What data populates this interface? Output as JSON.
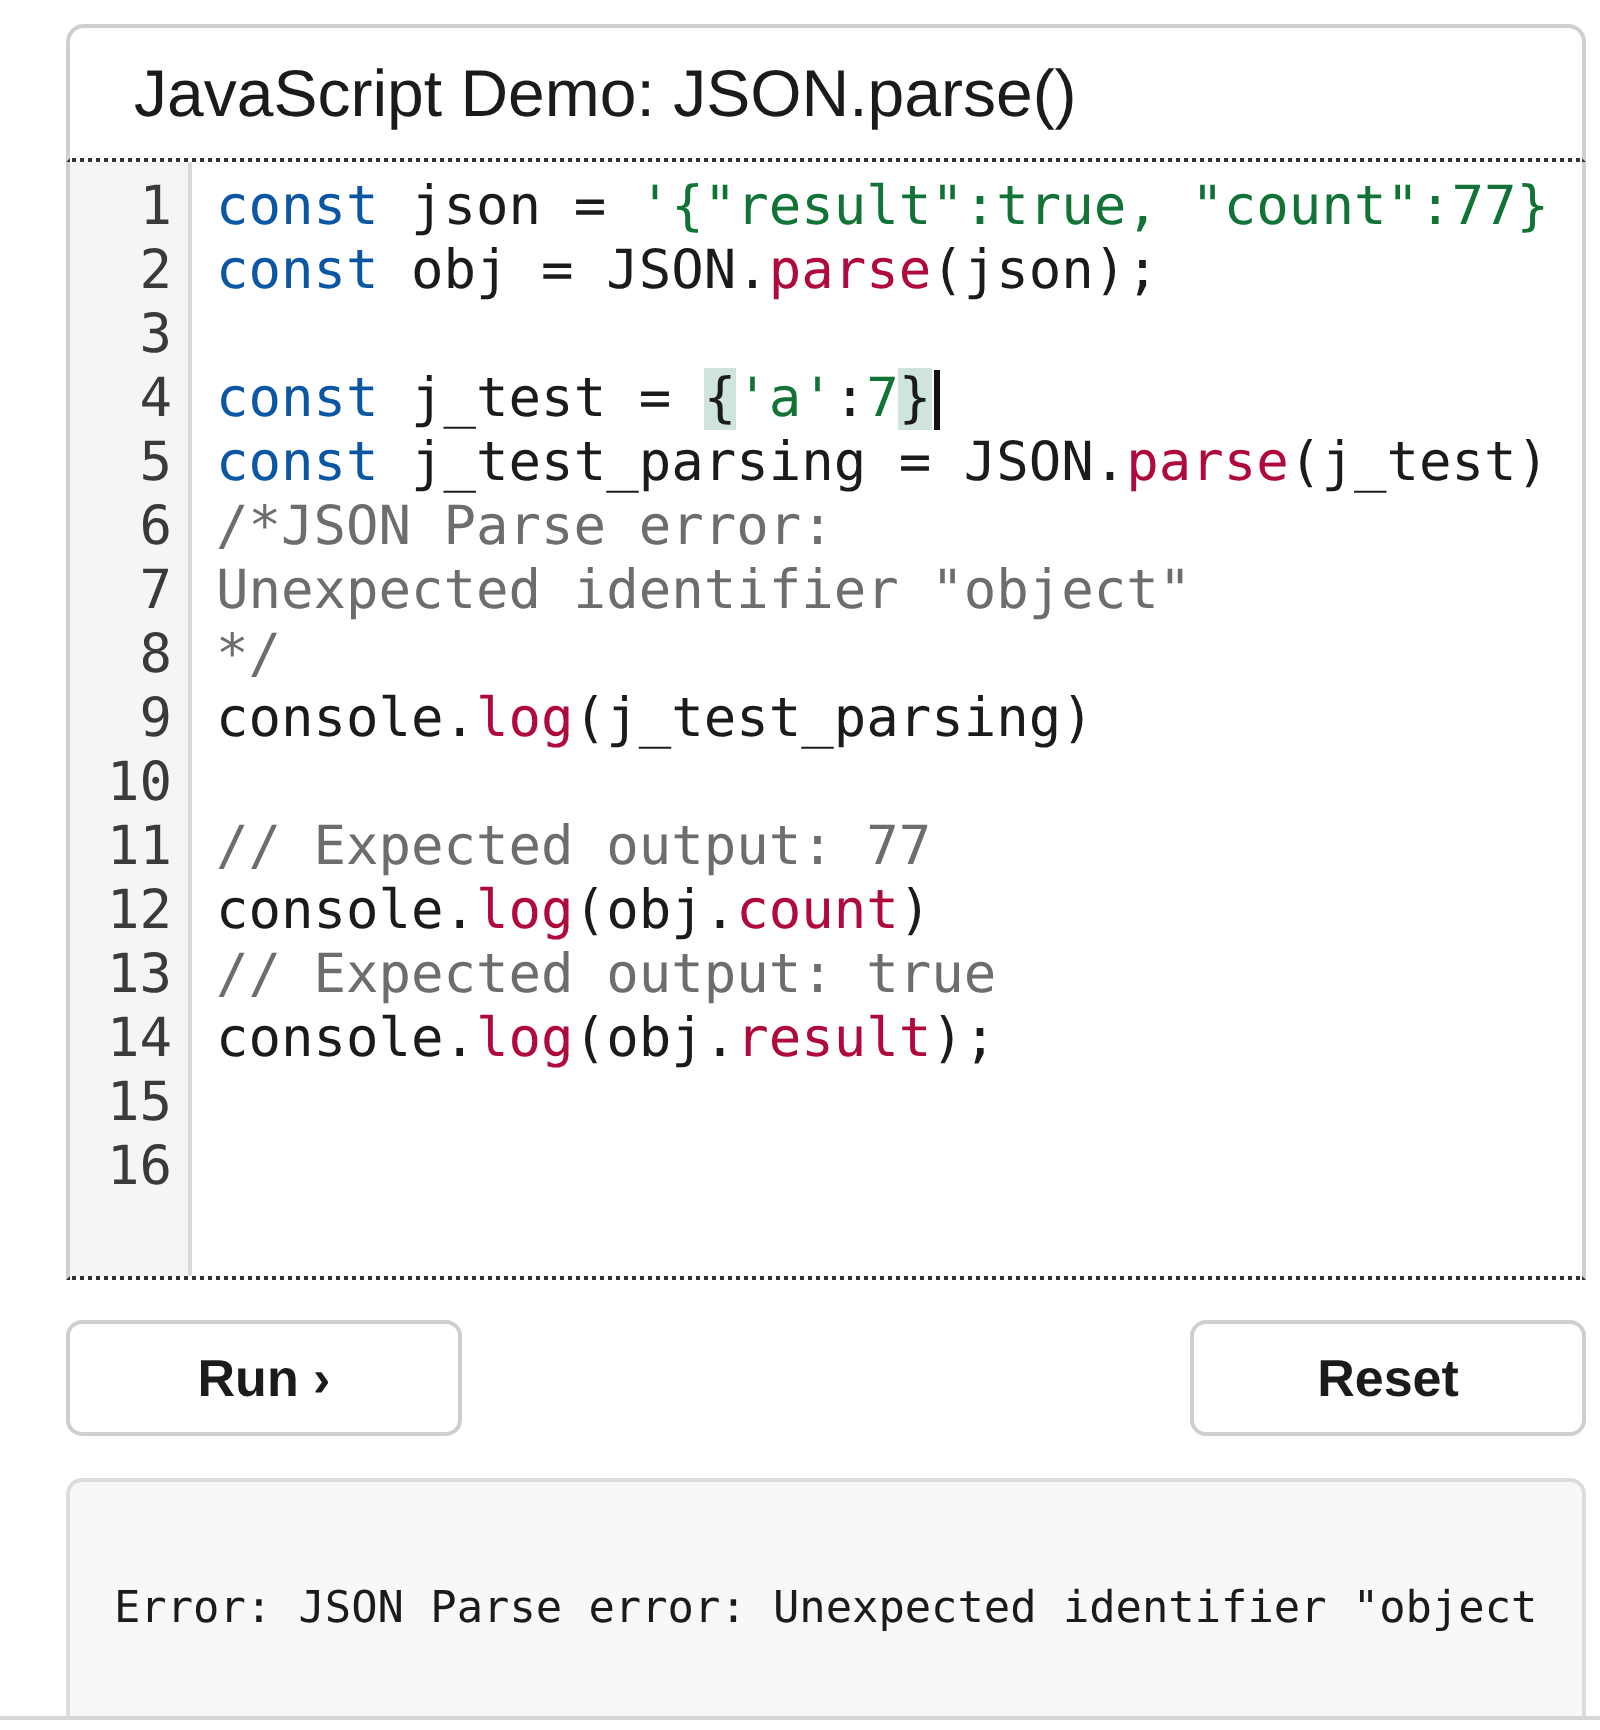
{
  "demo": {
    "title": "JavaScript Demo: JSON.parse()"
  },
  "editor": {
    "lines": [
      {
        "number": "1",
        "cursor": false,
        "tokens": [
          {
            "kind": "keyword",
            "text": "const"
          },
          {
            "kind": "plain",
            "text": " json = "
          },
          {
            "kind": "string",
            "text": "'{\"result\":true, \"count\":77}"
          }
        ]
      },
      {
        "number": "2",
        "cursor": false,
        "tokens": [
          {
            "kind": "keyword",
            "text": "const"
          },
          {
            "kind": "plain",
            "text": " obj = JSON."
          },
          {
            "kind": "property",
            "text": "parse"
          },
          {
            "kind": "plain",
            "text": "(json);"
          }
        ]
      },
      {
        "number": "3",
        "cursor": false
      },
      {
        "number": "4",
        "cursor": true,
        "tokens": [
          {
            "kind": "keyword",
            "text": "const"
          },
          {
            "kind": "plain",
            "text": " j_test = "
          },
          {
            "kind": "matched",
            "text": "{"
          },
          {
            "kind": "string",
            "text": "'a'"
          },
          {
            "kind": "plain",
            "text": ":"
          },
          {
            "kind": "number",
            "text": "7"
          },
          {
            "kind": "matched",
            "text": "}"
          }
        ]
      },
      {
        "number": "5",
        "cursor": false,
        "tokens": [
          {
            "kind": "keyword",
            "text": "const"
          },
          {
            "kind": "plain",
            "text": " j_test_parsing = JSON."
          },
          {
            "kind": "property",
            "text": "parse"
          },
          {
            "kind": "plain",
            "text": "(j_test)"
          }
        ]
      },
      {
        "number": "6",
        "cursor": false,
        "tokens": [
          {
            "kind": "comment",
            "text": "/*JSON Parse error:"
          }
        ]
      },
      {
        "number": "7",
        "cursor": false,
        "tokens": [
          {
            "kind": "comment",
            "text": "Unexpected identifier \"object\""
          }
        ]
      },
      {
        "number": "8",
        "cursor": false,
        "tokens": [
          {
            "kind": "comment",
            "text": "*/"
          }
        ]
      },
      {
        "number": "9",
        "cursor": false,
        "tokens": [
          {
            "kind": "plain",
            "text": "console."
          },
          {
            "kind": "property",
            "text": "log"
          },
          {
            "kind": "plain",
            "text": "(j_test_parsing)"
          }
        ]
      },
      {
        "number": "10",
        "cursor": false
      },
      {
        "number": "11",
        "cursor": false,
        "tokens": [
          {
            "kind": "comment",
            "text": "// Expected output: 77"
          }
        ]
      },
      {
        "number": "12",
        "cursor": false,
        "tokens": [
          {
            "kind": "plain",
            "text": "console."
          },
          {
            "kind": "property",
            "text": "log"
          },
          {
            "kind": "plain",
            "text": "(obj."
          },
          {
            "kind": "property",
            "text": "count"
          },
          {
            "kind": "plain",
            "text": ")"
          }
        ]
      },
      {
        "number": "13",
        "cursor": false,
        "tokens": [
          {
            "kind": "comment",
            "text": "// Expected output: true"
          }
        ]
      },
      {
        "number": "14",
        "cursor": false,
        "tokens": [
          {
            "kind": "plain",
            "text": "console."
          },
          {
            "kind": "property",
            "text": "log"
          },
          {
            "kind": "plain",
            "text": "(obj."
          },
          {
            "kind": "property",
            "text": "result"
          },
          {
            "kind": "plain",
            "text": ");"
          }
        ]
      },
      {
        "number": "15",
        "cursor": false
      },
      {
        "number": "16",
        "cursor": false
      }
    ]
  },
  "run_button": {
    "label": "Run ›"
  },
  "reset_button": {
    "label": "Reset"
  },
  "output": {
    "text": "Error: JSON Parse error: Unexpected identifier \"object"
  }
}
